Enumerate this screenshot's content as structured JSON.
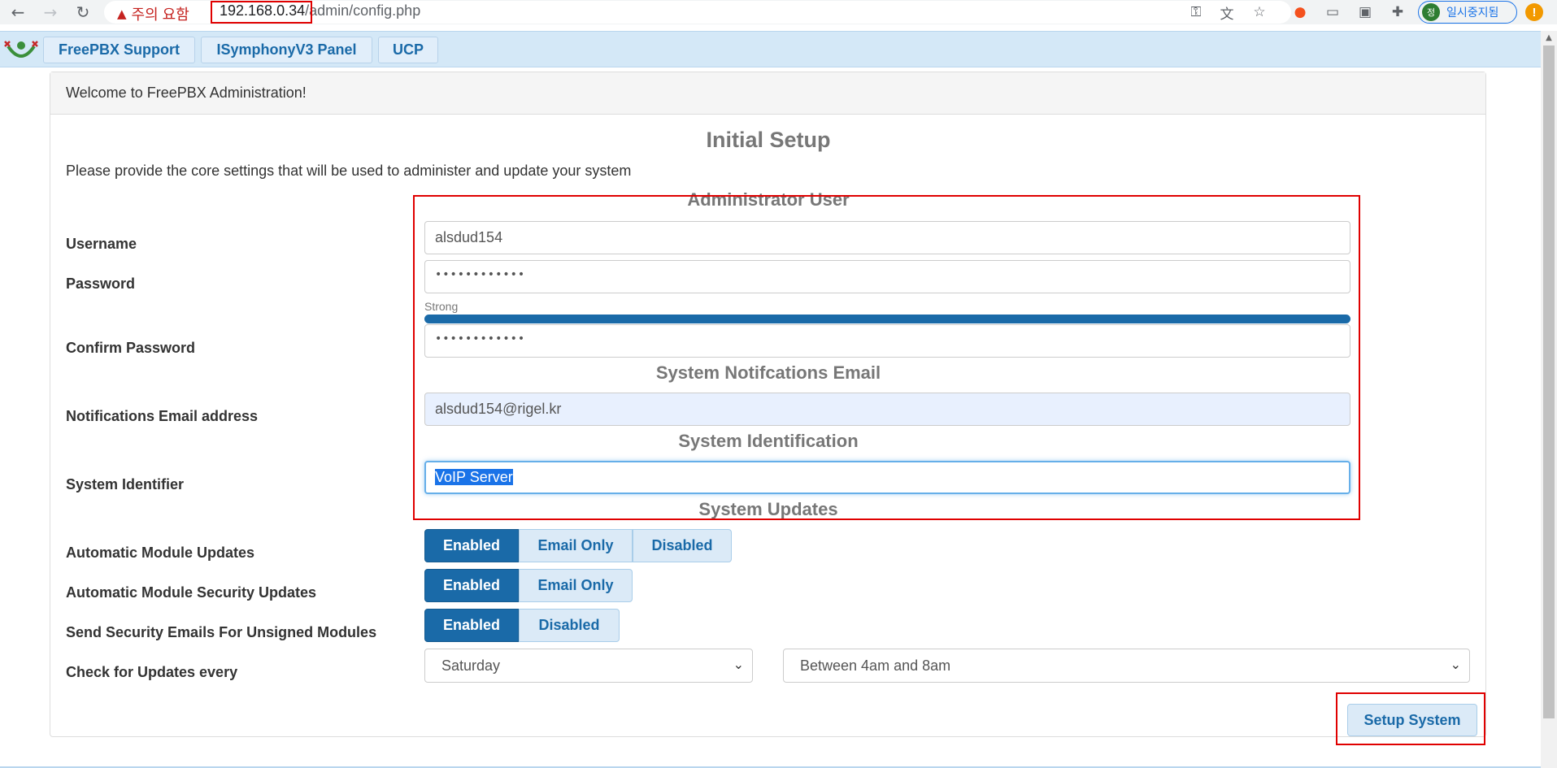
{
  "browser": {
    "warning_text": "주의 요함",
    "url_host": "192.168.0.34",
    "url_path": "/admin/config.php",
    "profile_label": "일시중지됨",
    "profile_initial": "정",
    "alert_glyph": "!"
  },
  "app_bar": {
    "tabs": [
      "FreePBX Support",
      "ISymphonyV3 Panel",
      "UCP"
    ]
  },
  "panel": {
    "heading": "Welcome to FreePBX Administration!",
    "title": "Initial Setup",
    "intro": "Please provide the core settings that will be used to administer and update your system"
  },
  "sections": {
    "admin_user": "Administrator User",
    "notifications": "System Notifcations Email",
    "identification": "System Identification",
    "updates": "System Updates"
  },
  "form": {
    "username_label": "Username",
    "username_value": "alsdud154",
    "password_label": "Password",
    "password_value": "••••••••••••",
    "strength_label": "Strong",
    "password_strength": 1.0,
    "confirm_label": "Confirm Password",
    "confirm_value": "••••••••••••",
    "email_label": "Notifications Email address",
    "email_value": "alsdud154@rigel.kr",
    "identifier_label": "System Identifier",
    "identifier_value": "VoIP Server",
    "auto_module_label": "Automatic Module Updates",
    "auto_module_options": [
      "Enabled",
      "Email Only",
      "Disabled"
    ],
    "auto_security_label": "Automatic Module Security Updates",
    "auto_security_options": [
      "Enabled",
      "Email Only"
    ],
    "unsigned_label": "Send Security Emails For Unsigned Modules",
    "unsigned_options": [
      "Enabled",
      "Disabled"
    ],
    "check_label": "Check for Updates every",
    "check_day": "Saturday",
    "check_time": "Between 4am and 8am",
    "submit_label": "Setup System"
  },
  "colors": {
    "accent": "#1a6aa8",
    "highlight_box": "#e00000",
    "app_bar_bg": "#d4e8f7"
  }
}
